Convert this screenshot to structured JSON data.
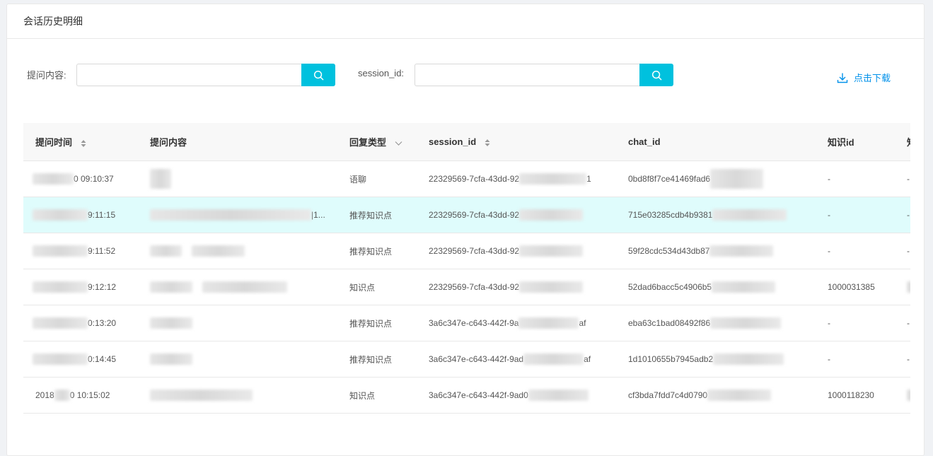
{
  "header": {
    "title": "会话历史明细"
  },
  "filters": {
    "question_label": "提问内容:",
    "question_value": "",
    "session_label": "session_id:",
    "session_value": "",
    "download_label": "点击下载"
  },
  "colors": {
    "accent": "#00c1de",
    "link": "#0091ea",
    "highlight_row": "#dffcfc"
  },
  "table": {
    "columns": [
      "提问时间",
      "提问内容",
      "回复类型",
      "session_id",
      "chat_id",
      "知识id",
      "知"
    ],
    "rows": [
      {
        "time": "0 09:10:37",
        "question": "",
        "type": "语聊",
        "session": "22329569-7cfa-43dd-92",
        "session_tail": "1",
        "chat": "0bd8f8f7ce41469fad6",
        "kid": "-",
        "extra": "-"
      },
      {
        "time": "9:11:15",
        "question": "|1...",
        "type": "推荐知识点",
        "session": "22329569-7cfa-43dd-92",
        "session_tail": "",
        "chat": "715e03285cdb4b9381",
        "kid": "-",
        "extra": "-"
      },
      {
        "time": "9:11:52",
        "question": "",
        "type": "推荐知识点",
        "session": "22329569-7cfa-43dd-92",
        "session_tail": "",
        "chat": "59f28cdc534d43db87",
        "kid": "-",
        "extra": "-"
      },
      {
        "time": "9:12:12",
        "question": "",
        "type": "知识点",
        "session": "22329569-7cfa-43dd-92",
        "session_tail": "",
        "chat": "52dad6bacc5c4906b5",
        "kid": "1000031385",
        "extra": ""
      },
      {
        "time": "0:13:20",
        "question": "",
        "type": "推荐知识点",
        "session": "3a6c347e-c643-442f-9a",
        "session_tail": "af",
        "chat": "eba63c1bad08492f86",
        "kid": "-",
        "extra": "-"
      },
      {
        "time": "0:14:45",
        "question": "",
        "type": "推荐知识点",
        "session": "3a6c347e-c643-442f-9ad",
        "session_tail": "af",
        "chat": "1d1010655b7945adb2",
        "kid": "-",
        "extra": "-"
      },
      {
        "time_prefix": "2018",
        "time": "0 10:15:02",
        "question": "",
        "type": "知识点",
        "session": "3a6c347e-c643-442f-9ad0",
        "session_tail": "",
        "chat": "cf3bda7fdd7c4d0790",
        "kid": "1000118230",
        "extra": ""
      }
    ]
  }
}
